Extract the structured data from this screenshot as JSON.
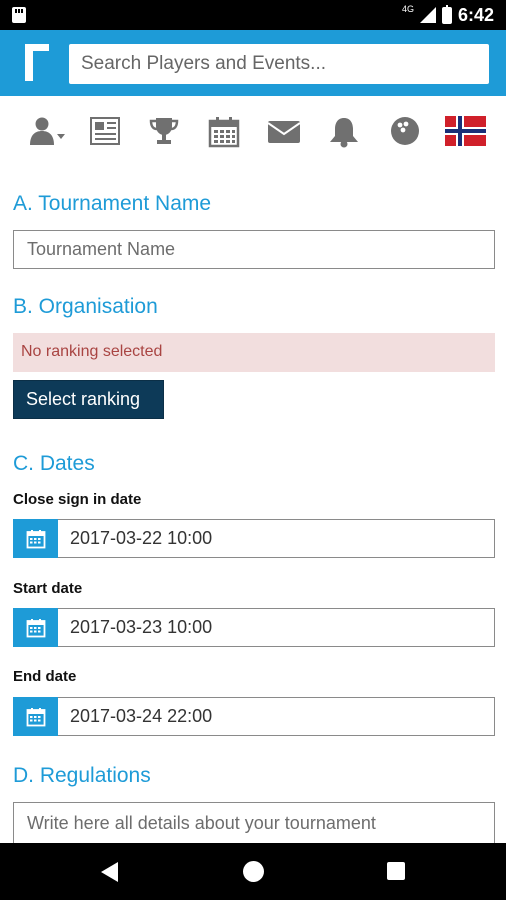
{
  "status_bar": {
    "network": "4G",
    "time": "6:42"
  },
  "search": {
    "placeholder": "Search Players and Events..."
  },
  "nav_icons": [
    "user-menu-icon",
    "news-icon",
    "trophy-icon",
    "calendar-icon",
    "mail-icon",
    "bell-icon",
    "bowling-ball-icon",
    "norway-flag-icon"
  ],
  "colors": {
    "accent": "#1e9bd7",
    "button": "#0d3a58",
    "alert_bg": "#f2dede",
    "alert_text": "#a94442"
  },
  "sections": {
    "a_title": "A. Tournament Name",
    "tournament_name_placeholder": "Tournament Name",
    "b_title": "B. Organisation",
    "no_ranking": "No ranking selected",
    "select_ranking": "Select ranking",
    "c_title": "C. Dates",
    "close_signin_label": "Close sign in date",
    "close_signin_value": "2017-03-22 10:00",
    "start_label": "Start date",
    "start_value": "2017-03-23 10:00",
    "end_label": "End date",
    "end_value": "2017-03-24 22:00",
    "d_title": "D. Regulations",
    "regulations_placeholder": "Write here all details about your tournament"
  }
}
